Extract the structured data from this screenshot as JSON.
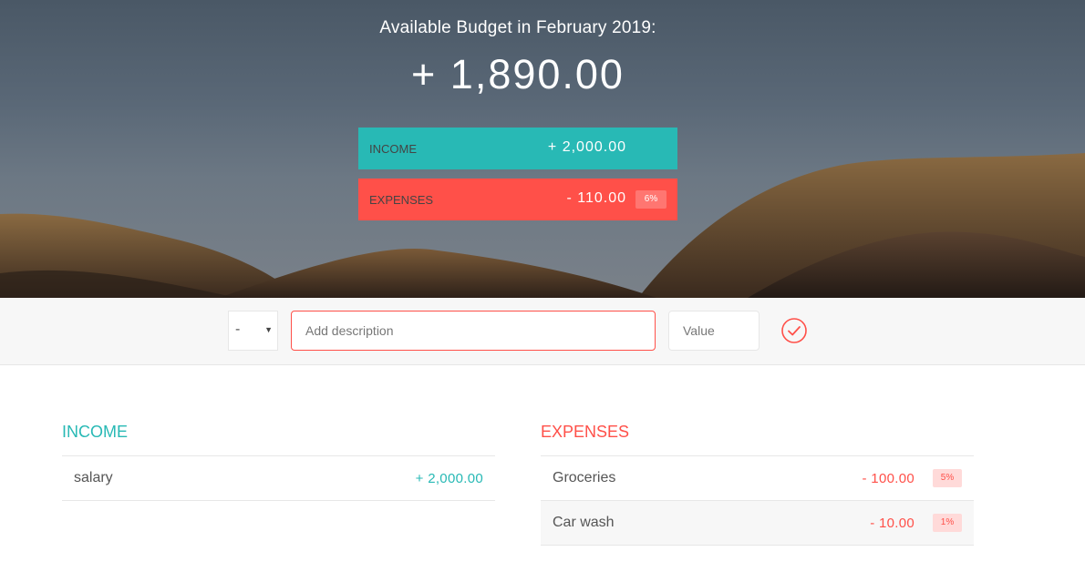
{
  "header": {
    "title": "Available Budget in February 2019:",
    "budget_value": "+ 1,890.00",
    "income": {
      "label": "INCOME",
      "value": "+ 2,000.00"
    },
    "expenses": {
      "label": "EXPENSES",
      "value": "- 110.00",
      "percentage": "6%"
    }
  },
  "add_bar": {
    "type_value": "-",
    "description_placeholder": "Add description",
    "value_placeholder": "Value",
    "submit_icon": "check-circle-icon"
  },
  "income_list": {
    "title": "INCOME",
    "items": [
      {
        "description": "salary",
        "value": "+ 2,000.00"
      }
    ]
  },
  "expenses_list": {
    "title": "EXPENSES",
    "items": [
      {
        "description": "Groceries",
        "value": "- 100.00",
        "percentage": "5%"
      },
      {
        "description": "Car wash",
        "value": "- 10.00",
        "percentage": "1%"
      }
    ]
  },
  "colors": {
    "income": "#28b9b5",
    "expenses": "#ff5049",
    "percentage_badge": "#ffdad9"
  }
}
